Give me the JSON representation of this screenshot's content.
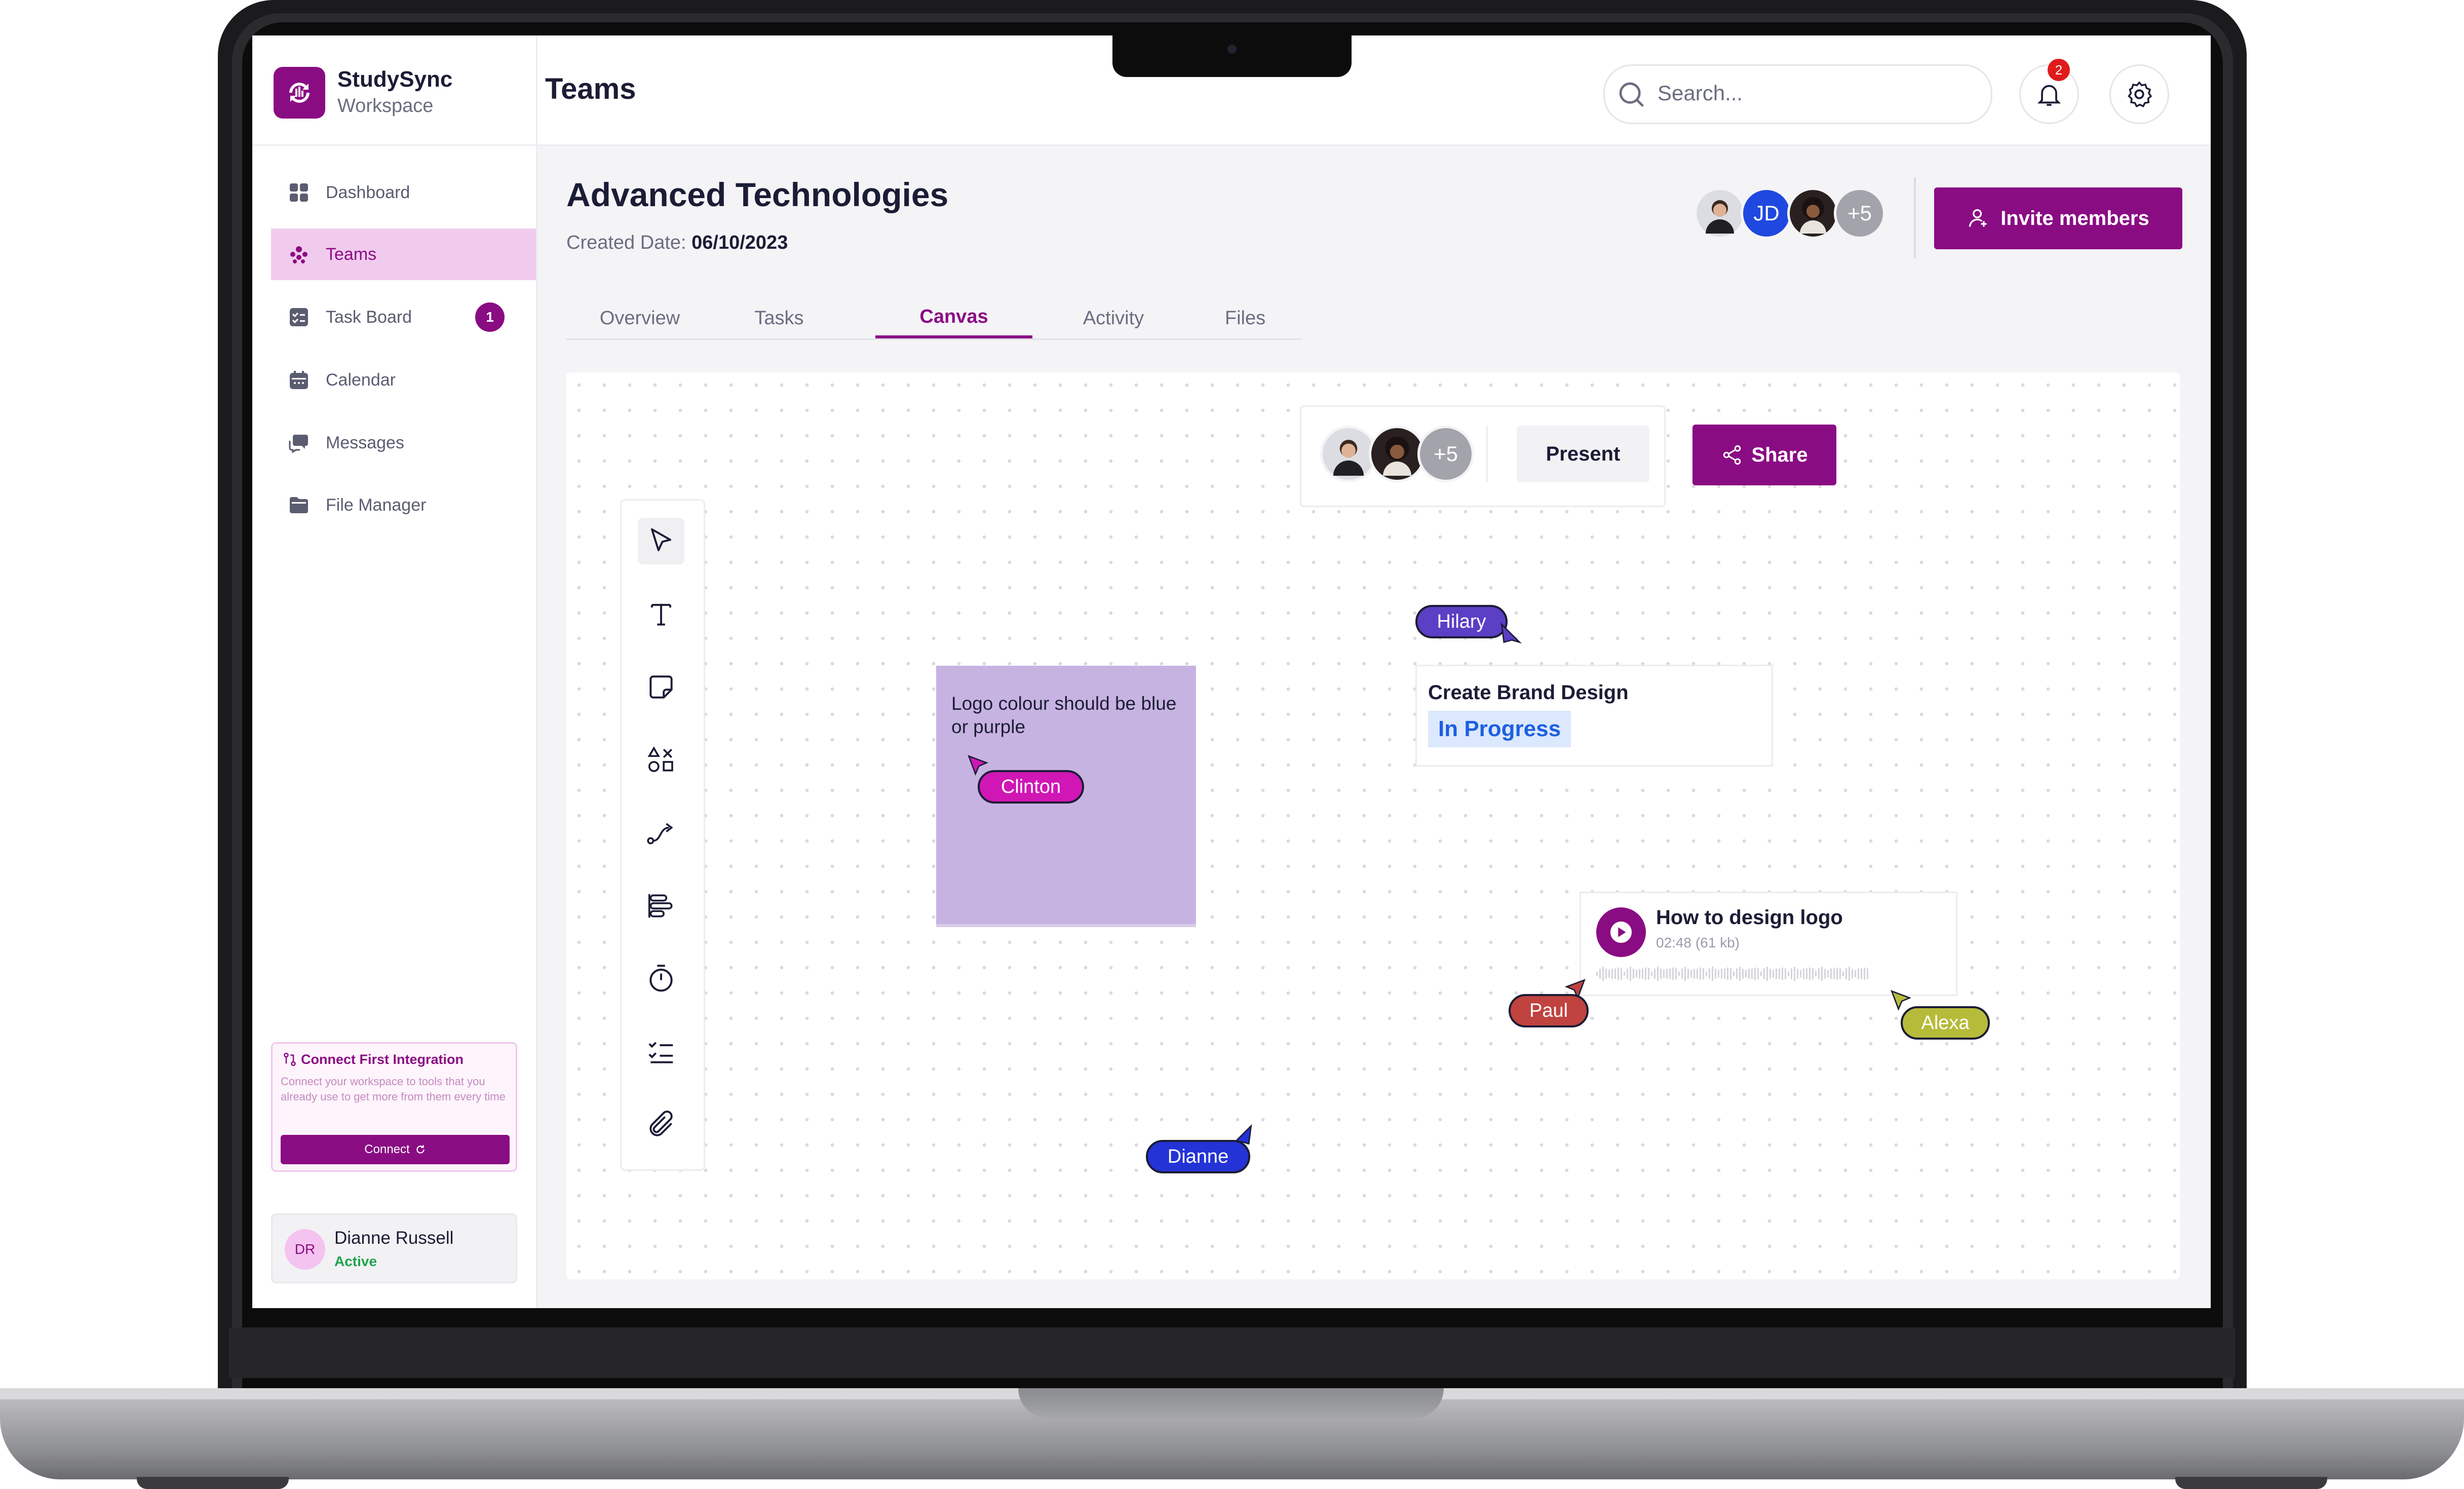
{
  "app": {
    "name": "StudySync",
    "subtitle": "Workspace",
    "page_title": "Teams"
  },
  "sidebar": {
    "items": [
      {
        "label": "Dashboard",
        "icon": "grid-icon"
      },
      {
        "label": "Teams",
        "icon": "team-icon",
        "active": true
      },
      {
        "label": "Task Board",
        "icon": "checklist-icon",
        "badge": "1"
      },
      {
        "label": "Calendar",
        "icon": "calendar-icon"
      },
      {
        "label": "Messages",
        "icon": "chat-icon"
      },
      {
        "label": "File Manager",
        "icon": "folder-icon"
      }
    ],
    "integration": {
      "title": "Connect First Integration",
      "description": "Connect your workspace to tools that you already use to get more from them every time",
      "button": "Connect"
    },
    "user": {
      "initials": "DR",
      "name": "Dianne Russell",
      "status": "Active"
    }
  },
  "header": {
    "search_placeholder": "Search...",
    "notification_count": "2"
  },
  "team": {
    "name": "Advanced Technologies",
    "created_label": "Created Date:",
    "created_date": "06/10/2023",
    "member_initials": "JD",
    "more_members": "+5",
    "invite_label": "Invite members"
  },
  "tabs": [
    {
      "label": "Overview"
    },
    {
      "label": "Tasks"
    },
    {
      "label": "Canvas",
      "active": true
    },
    {
      "label": "Activity"
    },
    {
      "label": "Files"
    }
  ],
  "canvas": {
    "collaborators_more": "+5",
    "present_label": "Present",
    "share_label": "Share",
    "tools": [
      "cursor-icon",
      "text-icon",
      "sticky-note-icon",
      "shapes-icon",
      "connector-icon",
      "align-icon",
      "timer-icon",
      "checklist-icon",
      "attachment-icon"
    ],
    "sticky_note": {
      "text": "Logo colour should be blue or purple"
    },
    "task_card": {
      "title": "Create Brand Design",
      "status": "In Progress"
    },
    "audio_card": {
      "title": "How to design logo",
      "meta": "02:48 (61 kb)"
    },
    "cursors": {
      "hilary": {
        "name": "Hilary",
        "color": "#5b3fc4"
      },
      "clinton": {
        "name": "Clinton",
        "color": "#d016b5"
      },
      "paul": {
        "name": "Paul",
        "color": "#c0433f"
      },
      "alexa": {
        "name": "Alexa",
        "color": "#b7bb3a"
      },
      "dianne": {
        "name": "Dianne",
        "color": "#2433d6"
      }
    }
  },
  "colors": {
    "brand": "#8a0c83",
    "status_blue": "#1d5fe0"
  }
}
